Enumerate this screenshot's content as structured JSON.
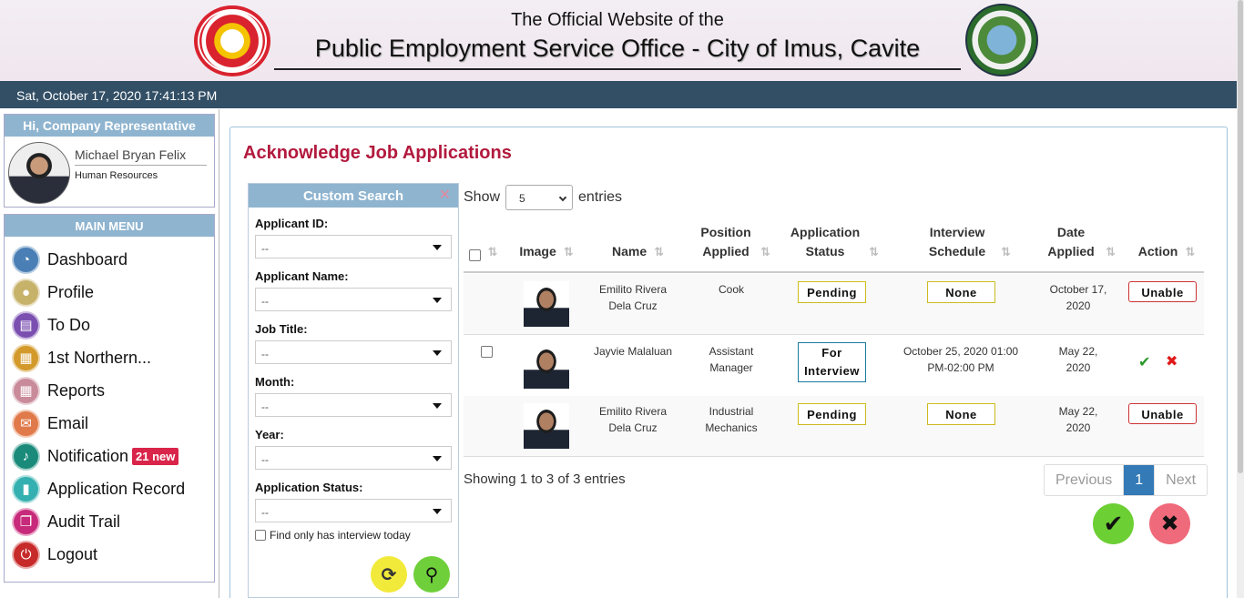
{
  "header": {
    "line1": "The Official Website of the",
    "line2": "Public Employment Service Office - City of Imus, Cavite"
  },
  "datetime": "Sat, October 17, 2020 17:41:13 PM",
  "profile": {
    "greeting": "Hi, Company Representative",
    "name": "Michael Bryan Felix",
    "role": "Human Resources"
  },
  "menu": {
    "title": "MAIN MENU",
    "items": [
      {
        "label": "Dashboard",
        "icon": "dashboard-icon",
        "color": "#4a7fb5"
      },
      {
        "label": "Profile",
        "icon": "user-icon",
        "color": "#c7b26a"
      },
      {
        "label": "To Do",
        "icon": "document-icon",
        "color": "#7a4fb0"
      },
      {
        "label": "1st Northern...",
        "icon": "building-icon",
        "color": "#d39a2b"
      },
      {
        "label": "Reports",
        "icon": "table-icon",
        "color": "#c98a9a"
      },
      {
        "label": "Email",
        "icon": "envelope-icon",
        "color": "#e07a4a"
      },
      {
        "label": "Notification",
        "icon": "bell-icon",
        "color": "#1a8a7a",
        "badge": "21 new"
      },
      {
        "label": "Application Record",
        "icon": "bookmark-icon",
        "color": "#35b0b0"
      },
      {
        "label": "Audit Trail",
        "icon": "copy-icon",
        "color": "#c72a7a"
      },
      {
        "label": "Logout",
        "icon": "power-icon",
        "color": "#c72a2a"
      }
    ]
  },
  "page_title": "Acknowledge Job Applications",
  "search": {
    "title": "Custom Search",
    "fields": [
      {
        "label": "Applicant ID:",
        "value": "--"
      },
      {
        "label": "Applicant Name:",
        "value": "--"
      },
      {
        "label": "Job Title:",
        "value": "--"
      },
      {
        "label": "Month:",
        "value": "--"
      },
      {
        "label": "Year:",
        "value": "--"
      },
      {
        "label": "Application Status:",
        "value": "--"
      }
    ],
    "interview_today": "Find only has interview today"
  },
  "table": {
    "show": "Show",
    "entries_value": "5",
    "entries": "entries",
    "columns": [
      "Image",
      "Name",
      "Position Applied",
      "Application Status",
      "Interview Schedule",
      "Date Applied",
      "Action"
    ],
    "rows": [
      {
        "name": "Emilito Rivera Dela Cruz",
        "position": "Cook",
        "status": "Pending",
        "schedule": "None",
        "date": "October 17, 2020",
        "action": "Unable"
      },
      {
        "name": "Jayvie Malaluan",
        "position": "Assistant Manager",
        "status": "For Interview",
        "schedule": "October 25, 2020 01:00 PM-02:00 PM",
        "date": "May 22, 2020",
        "action": ""
      },
      {
        "name": "Emilito Rivera Dela Cruz",
        "position": "Industrial Mechanics",
        "status": "Pending",
        "schedule": "None",
        "date": "May 22, 2020",
        "action": "Unable"
      }
    ],
    "showing": "Showing 1 to 3 of 3 entries",
    "pager": {
      "previous": "Previous",
      "current": "1",
      "next": "Next"
    }
  }
}
